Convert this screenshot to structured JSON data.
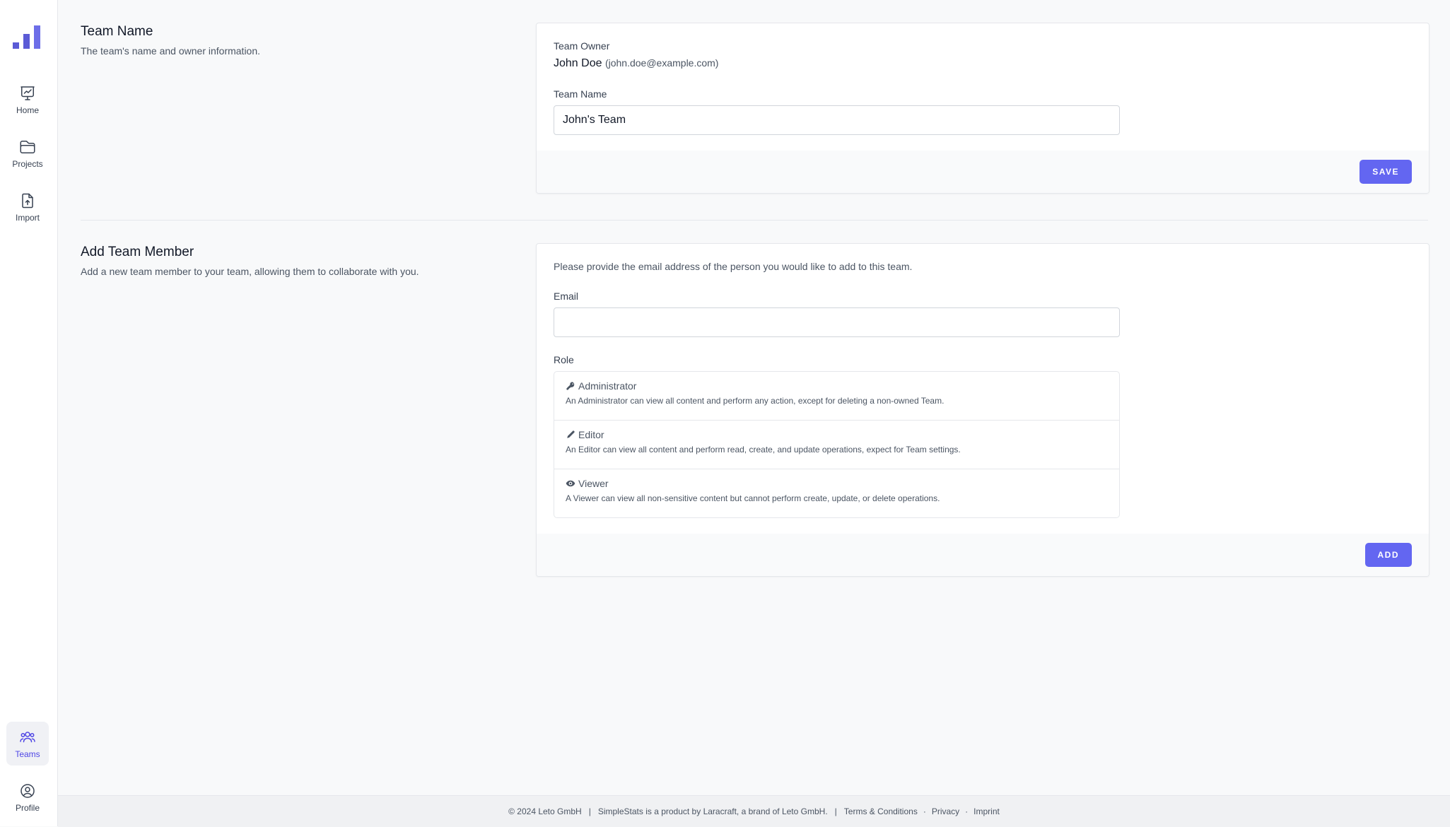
{
  "nav": {
    "items": [
      {
        "label": "Home",
        "icon": "presentation-chart-icon"
      },
      {
        "label": "Projects",
        "icon": "folder-icon"
      },
      {
        "label": "Import",
        "icon": "document-arrow-up-icon"
      }
    ],
    "bottom_items": [
      {
        "label": "Teams",
        "icon": "user-group-icon",
        "active": true
      },
      {
        "label": "Profile",
        "icon": "user-circle-icon"
      }
    ]
  },
  "team_name_section": {
    "title": "Team Name",
    "description": "The team's name and owner information.",
    "owner_label": "Team Owner",
    "owner_name": "John Doe",
    "owner_email": "(john.doe@example.com)",
    "name_label": "Team Name",
    "name_value": "John's Team",
    "save_label": "SAVE"
  },
  "add_member_section": {
    "title": "Add Team Member",
    "description": "Add a new team member to your team, allowing them to collaborate with you.",
    "intro": "Please provide the email address of the person you would like to add to this team.",
    "email_label": "Email",
    "email_value": "",
    "role_label": "Role",
    "roles": [
      {
        "name": "Administrator",
        "icon": "key-icon",
        "description": "An Administrator can view all content and perform any action, except for deleting a non-owned Team."
      },
      {
        "name": "Editor",
        "icon": "pencil-icon",
        "description": "An Editor can view all content and perform read, create, and update operations, expect for Team settings."
      },
      {
        "name": "Viewer",
        "icon": "eye-icon",
        "description": "A Viewer can view all non-sensitive content but cannot perform create, update, or delete operations."
      }
    ],
    "add_label": "ADD"
  },
  "footer": {
    "copyright": "© 2024 Leto GmbH",
    "product": "SimpleStats is a product by Laracraft, a brand of Leto GmbH.",
    "links": [
      "Terms & Conditions",
      "Privacy",
      "Imprint"
    ],
    "separator": "|",
    "dot": "·"
  },
  "colors": {
    "accent": "#6366f1",
    "logo": "#5b5bd6",
    "active_nav": "#4f46e5"
  }
}
